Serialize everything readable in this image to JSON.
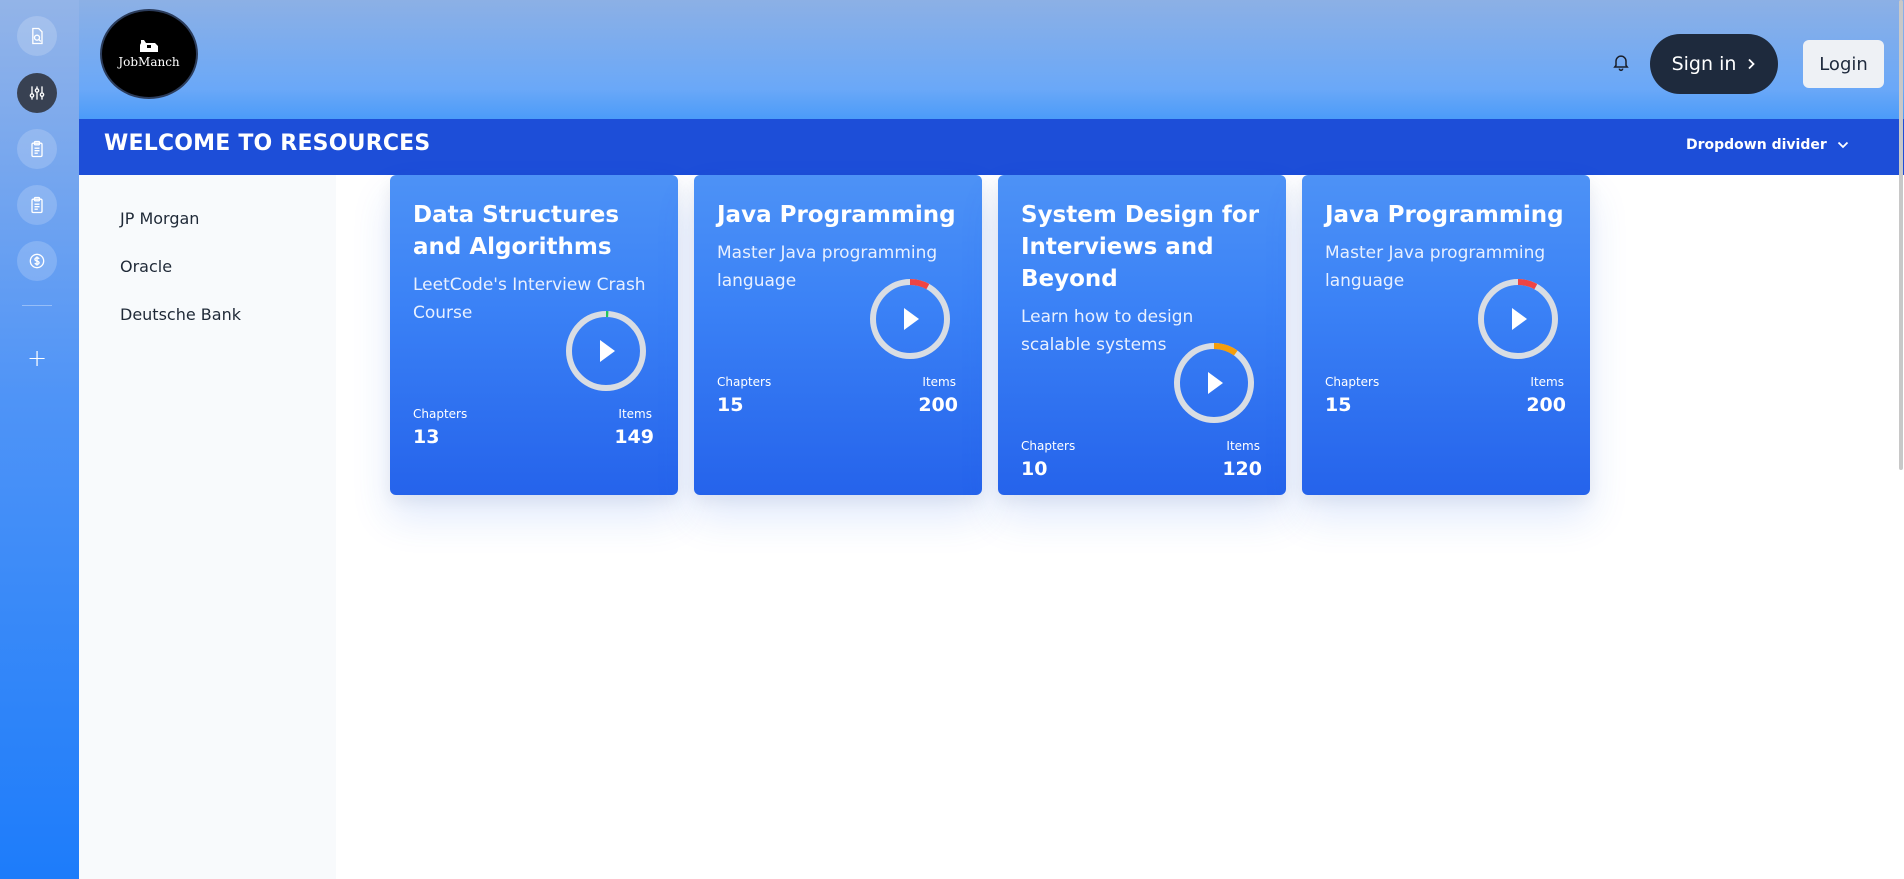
{
  "brand": {
    "logo_text": "JobManch"
  },
  "header": {
    "signin_label": "Sign in",
    "login_label": "Login"
  },
  "banner": {
    "title": "WELCOME TO RESOURCES",
    "dropdown_label": "Dropdown divider"
  },
  "sidebar": {
    "companies": [
      "JP Morgan",
      "Oracle",
      "Deutsche Bank"
    ]
  },
  "rail": {
    "icons": [
      "document-search-icon",
      "sliders-icon",
      "clipboard-icon",
      "clipboard-icon",
      "dollar-icon",
      "plus-icon"
    ]
  },
  "courses": [
    {
      "title": "Data Structures and Algorithms",
      "description": "LeetCode's Interview Crash Course",
      "chapters_label": "Chapters",
      "chapters": "13",
      "items_label": "Items",
      "items": "149",
      "progress": 0.01,
      "progress_color": "#22c55e"
    },
    {
      "title": "Java Programming",
      "description": "Master Java programming language",
      "chapters_label": "Chapters",
      "chapters": "15",
      "items_label": "Items",
      "items": "200",
      "progress": 0.08,
      "progress_color": "#ef4444"
    },
    {
      "title": "System Design for Interviews and Beyond",
      "description": "Learn how to design scalable systems",
      "chapters_label": "Chapters",
      "chapters": "10",
      "items_label": "Items",
      "items": "120",
      "progress": 0.1,
      "progress_color": "#f59e0b"
    },
    {
      "title": "Java Programming",
      "description": "Master Java programming language",
      "chapters_label": "Chapters",
      "chapters": "15",
      "items_label": "Items",
      "items": "200",
      "progress": 0.08,
      "progress_color": "#ef4444"
    }
  ]
}
